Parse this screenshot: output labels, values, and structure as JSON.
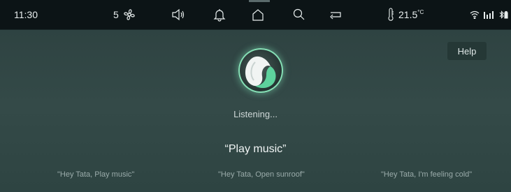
{
  "status_bar": {
    "time": "11:30",
    "fan_speed": "5",
    "temperature": "21.5",
    "temperature_unit": "°C",
    "icons": [
      "fan-icon",
      "volume-icon",
      "bell-icon",
      "home-icon",
      "search-icon",
      "back-icon",
      "thermometer-icon",
      "wifi-icon",
      "signal-icon",
      "bluetooth-icon"
    ]
  },
  "help_button": {
    "label": "Help"
  },
  "assistant": {
    "status": "Listening...",
    "command": "“Play music”"
  },
  "suggestions": [
    "\"Hey Tata, Play music\"",
    "\"Hey Tata, Open sunroof\"",
    "\"Hey Tata, I'm feeling cold\""
  ],
  "colors": {
    "accent_green": "#86e0b6",
    "status_bar_bg": "#0c1416",
    "background": "#344a48"
  }
}
